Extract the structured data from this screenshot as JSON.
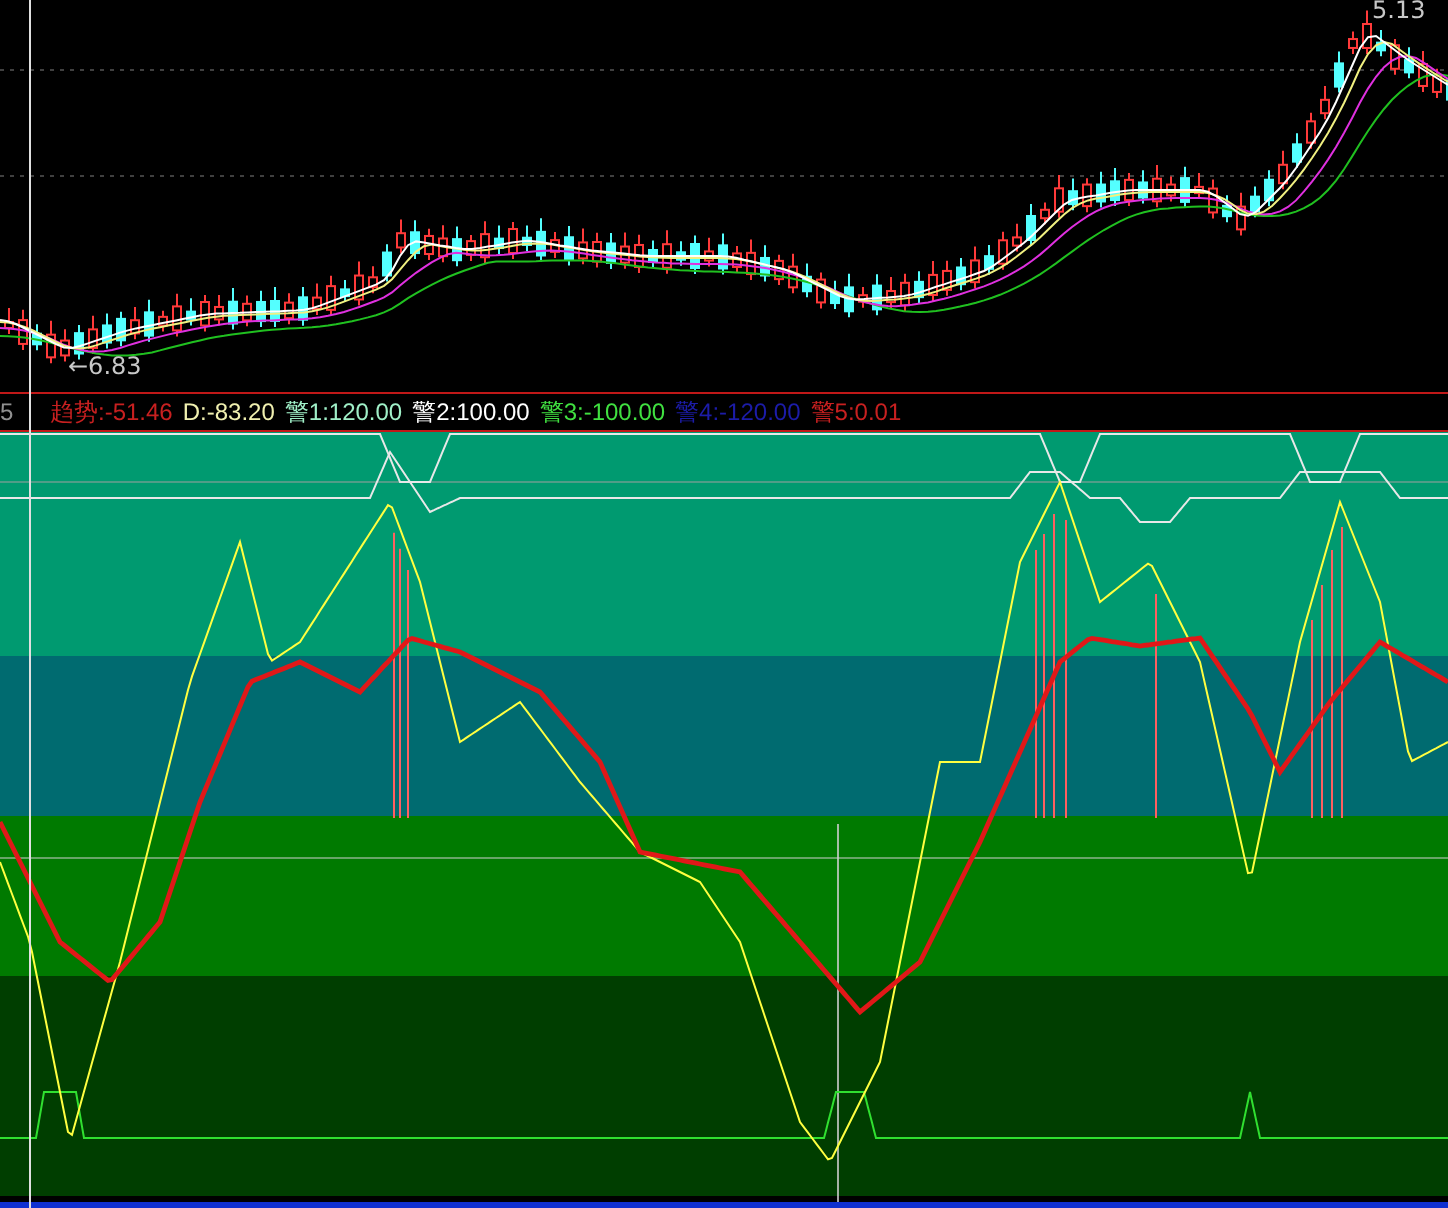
{
  "price_panel": {
    "high_label": "5.13",
    "low_label": "←6.83"
  },
  "indicator_legend": {
    "cut_label": "5",
    "items": [
      {
        "text": "趋势:-51.46",
        "color": "#c82020"
      },
      {
        "text": "D:-83.20",
        "color": "#f0f0b0"
      },
      {
        "text": "警1:120.00",
        "color": "#a0f0c8"
      },
      {
        "text": "警2:100.00",
        "color": "#ffffff"
      },
      {
        "text": "警3:-100.00",
        "color": "#40e040"
      },
      {
        "text": "警4:-120.00",
        "color": "#1c1ca8"
      },
      {
        "text": "警5:0.01",
        "color": "#c82020"
      }
    ]
  }
}
